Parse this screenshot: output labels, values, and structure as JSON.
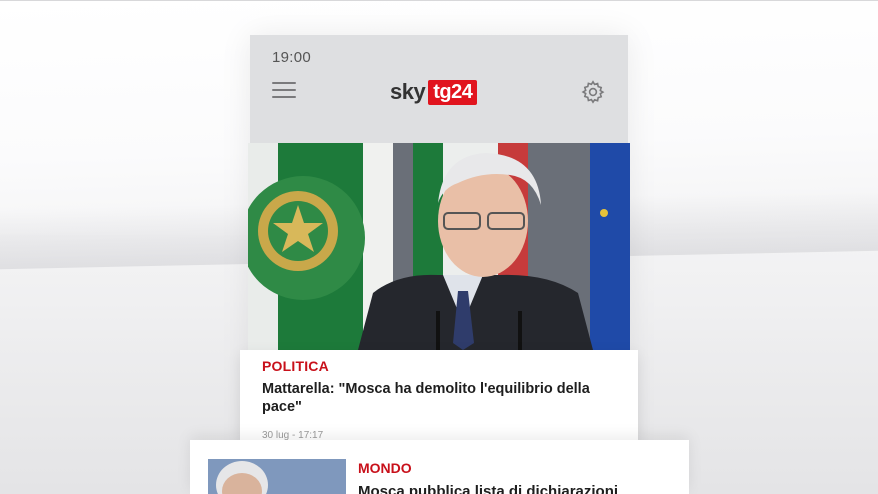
{
  "status_bar": {
    "time": "19:00"
  },
  "header": {
    "logo_sky": "sky",
    "logo_tg": "tg24",
    "menu_icon": "hamburger-menu-icon",
    "settings_icon": "gear-icon"
  },
  "hero_article": {
    "category": "POLITICA",
    "headline": "Mattarella: \"Mosca ha demolito l'equilibrio della pace\"",
    "timestamp": "30 lug - 17:17"
  },
  "next_article": {
    "category": "MONDO",
    "headline": "Mosca pubblica lista di dichiarazioni"
  },
  "colors": {
    "accent_red": "#e1141e",
    "category_red": "#c8101a",
    "header_bg": "#dedfe1"
  }
}
